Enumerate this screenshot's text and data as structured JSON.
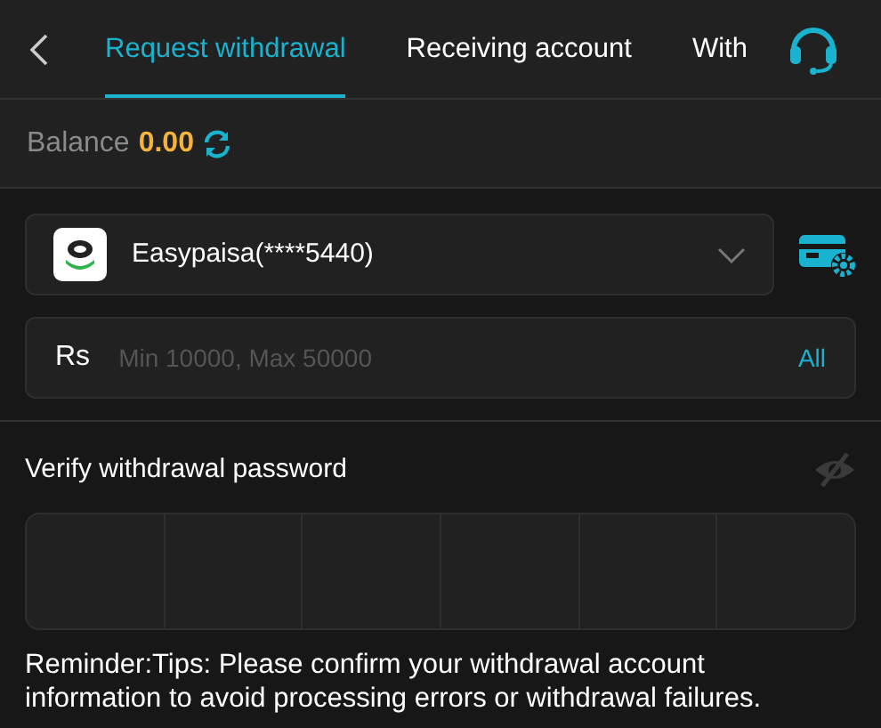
{
  "tabs": [
    {
      "label": "Request withdrawal",
      "selected": true
    },
    {
      "label": "Receiving account",
      "selected": false
    },
    {
      "label": "With",
      "selected": false
    }
  ],
  "balance": {
    "label": "Balance",
    "amount": "0.00"
  },
  "account": {
    "name": "Easypaisa(****5440)"
  },
  "amount_field": {
    "currency": "Rs",
    "placeholder": "Min 10000, Max 50000",
    "all_button": "All"
  },
  "password": {
    "label": "Verify withdrawal password",
    "visible": false
  },
  "reminder": "Reminder:Tips: Please confirm your withdrawal account information to avoid processing errors or withdrawal failures."
}
